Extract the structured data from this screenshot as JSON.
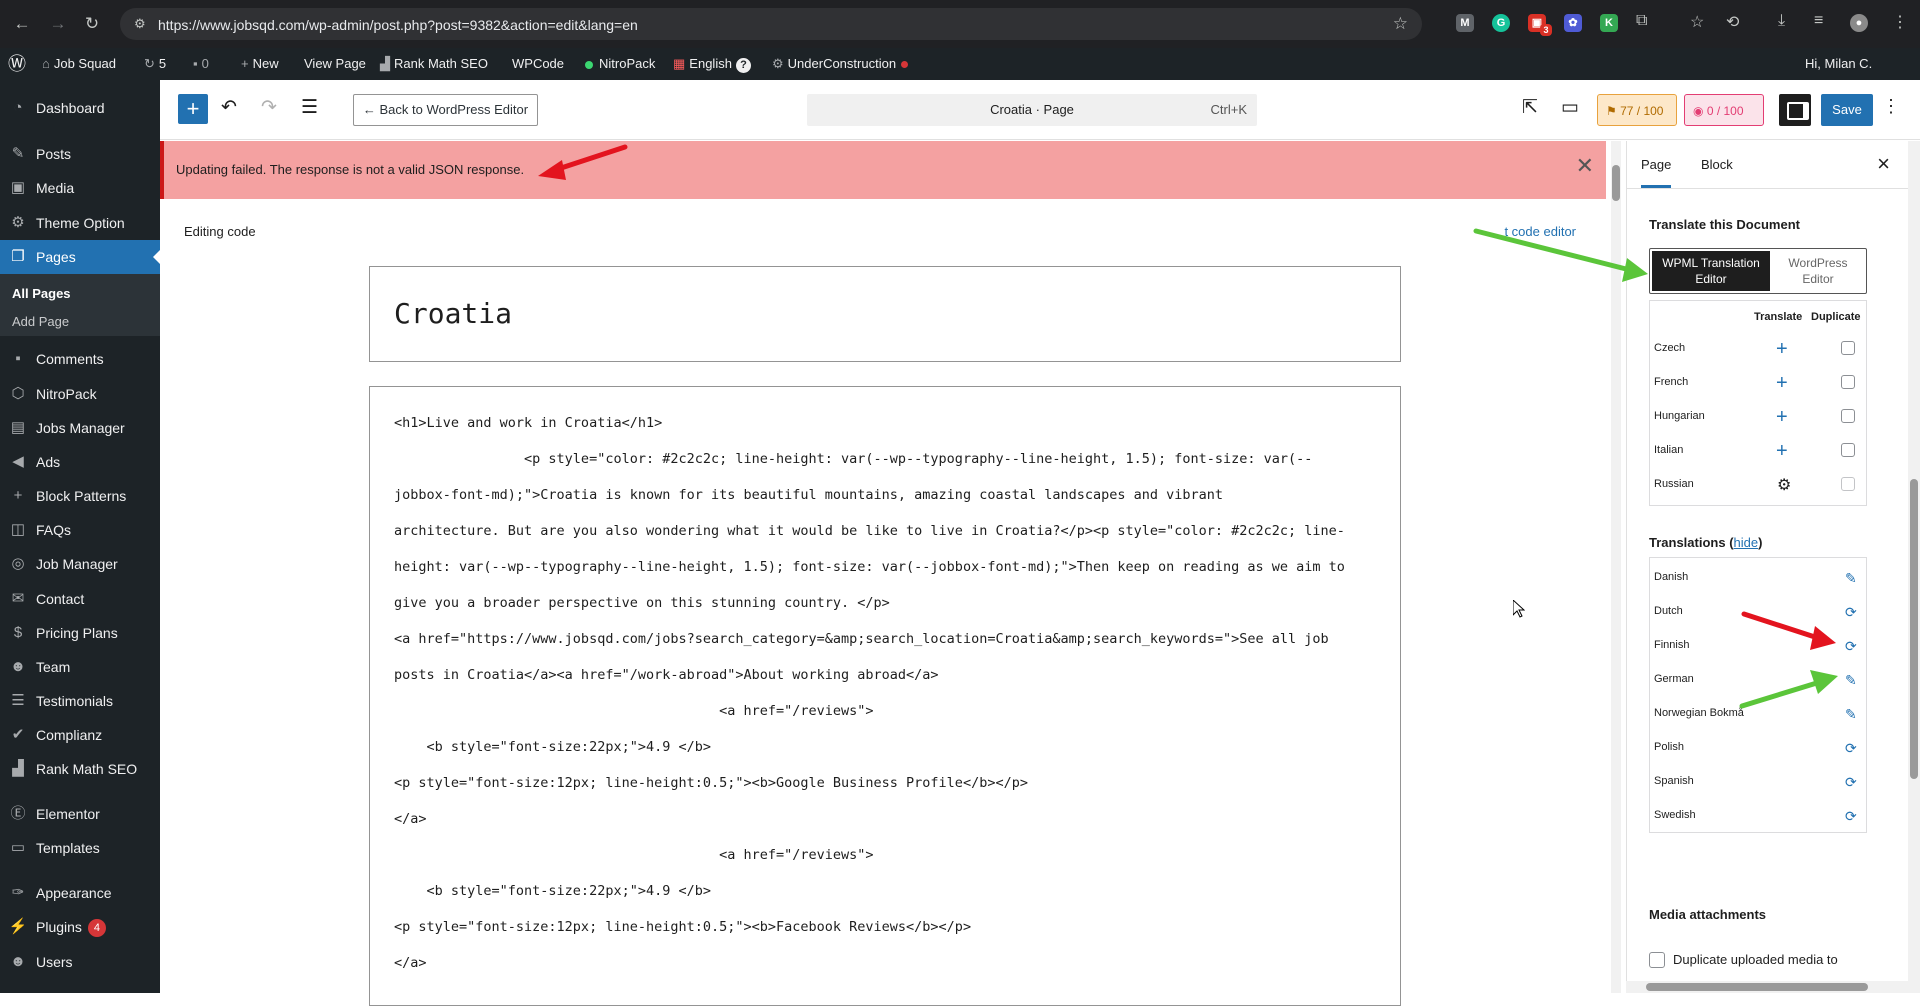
{
  "browser": {
    "url": "https://www.jobsqd.com/wp-admin/post.php?post=9382&action=edit&lang=en",
    "ext_badge": "3"
  },
  "adminbar": {
    "site_name": "Job Squad",
    "updates_count": "5",
    "comments_count": "0",
    "new_label": "New",
    "view_page": "View Page",
    "rank_math": "Rank Math SEO",
    "wpcode": "WPCode",
    "nitropack": "NitroPack",
    "language": "English",
    "under_construction": "UnderConstruction",
    "greeting": "Hi, Milan C."
  },
  "sidebar": {
    "items": [
      {
        "label": "Dashboard",
        "icon": "dashboard-icon"
      },
      {
        "label": "Posts",
        "icon": "pin-icon"
      },
      {
        "label": "Media",
        "icon": "media-icon"
      },
      {
        "label": "Theme Option",
        "icon": "gear-icon"
      },
      {
        "label": "Pages",
        "icon": "pages-icon"
      },
      {
        "label": "Comments",
        "icon": "comment-icon"
      },
      {
        "label": "NitroPack",
        "icon": "nitropack-icon"
      },
      {
        "label": "Jobs Manager",
        "icon": "briefcase-icon"
      },
      {
        "label": "Ads",
        "icon": "megaphone-icon"
      },
      {
        "label": "Block Patterns",
        "icon": "plus-icon"
      },
      {
        "label": "FAQs",
        "icon": "bubble-icon"
      },
      {
        "label": "Job Manager",
        "icon": "jm-icon"
      },
      {
        "label": "Contact",
        "icon": "mail-icon"
      },
      {
        "label": "Pricing Plans",
        "icon": "dollar-icon"
      },
      {
        "label": "Team",
        "icon": "user-icon"
      },
      {
        "label": "Testimonials",
        "icon": "list-icon"
      },
      {
        "label": "Complianz",
        "icon": "check-icon"
      },
      {
        "label": "Rank Math SEO",
        "icon": "chart-icon"
      },
      {
        "label": "Elementor",
        "icon": "elementor-icon"
      },
      {
        "label": "Templates",
        "icon": "folder-icon"
      },
      {
        "label": "Appearance",
        "icon": "brush-icon"
      },
      {
        "label": "Plugins",
        "icon": "plug-icon"
      },
      {
        "label": "Users",
        "icon": "user-icon"
      }
    ],
    "submenu": {
      "all_pages": "All Pages",
      "add_page": "Add Page"
    },
    "plugins_badge": "4"
  },
  "toolbar": {
    "back_label": "← Back to WordPress Editor",
    "doc_title": "Croatia · Page",
    "shortcut": "Ctrl+K",
    "seo_score": "77 / 100",
    "readability_score": "0 / 100",
    "save_label": "Save"
  },
  "notice": {
    "text": "Updating failed. The response is not a valid JSON response."
  },
  "editor": {
    "editing_code": "Editing code",
    "exit_code": "t code editor",
    "title": "Croatia",
    "code_lines": [
      "<h1>Live and work in Croatia</h1>",
      "                <p style=\"color: #2c2c2c; line-height: var(--wp--typography--line-height, 1.5); font-size: var(--",
      "jobbox-font-md);\">Croatia is known for its beautiful mountains, amazing coastal landscapes and vibrant",
      "architecture. But are you also wondering what it would be like to live in Croatia?</p><p style=\"color: #2c2c2c; line-",
      "height: var(--wp--typography--line-height, 1.5); font-size: var(--jobbox-font-md);\">Then keep on reading as we aim to",
      "give you a broader perspective on this stunning country. </p>",
      "<a href=\"https://www.jobsqd.com/jobs?search_category=&amp;search_location=Croatia&amp;search_keywords=\">See all job",
      "posts in Croatia</a><a href=\"/work-abroad\">About working abroad</a>",
      "                                        <a href=\"/reviews\">",
      "    <b style=\"font-size:22px;\">4.9 </b>",
      "<p style=\"font-size:12px; line-height:0.5;\"><b>Google Business Profile</b></p>",
      "</a>",
      "                                        <a href=\"/reviews\">",
      "    <b style=\"font-size:22px;\">4.9 </b>",
      "<p style=\"font-size:12px; line-height:0.5;\"><b>Facebook Reviews</b></p>",
      "</a>"
    ]
  },
  "settings": {
    "tab_page": "Page",
    "tab_block": "Block",
    "translate_heading": "Translate this Document",
    "wpml_editor": "WPML Translation Editor",
    "wp_editor": "WordPress Editor",
    "col_translate": "Translate",
    "col_duplicate": "Duplicate",
    "languages": [
      {
        "name": "Czech",
        "action": "plus-icon"
      },
      {
        "name": "French",
        "action": "plus-icon"
      },
      {
        "name": "Hungarian",
        "action": "plus-icon"
      },
      {
        "name": "Italian",
        "action": "plus-icon"
      },
      {
        "name": "Russian",
        "action": "gear-icon"
      }
    ],
    "translations_label": "Translations (",
    "hide_label": "hide",
    "translations_close": ")",
    "translations": [
      {
        "name": "Danish",
        "icon": "pencil-icon"
      },
      {
        "name": "Dutch",
        "icon": "refresh-icon"
      },
      {
        "name": "Finnish",
        "icon": "refresh-icon"
      },
      {
        "name": "German",
        "icon": "pencil-icon"
      },
      {
        "name": "Norwegian Bokmå",
        "icon": "pencil-icon"
      },
      {
        "name": "Polish",
        "icon": "refresh-icon"
      },
      {
        "name": "Spanish",
        "icon": "refresh-icon"
      },
      {
        "name": "Swedish",
        "icon": "refresh-icon"
      }
    ],
    "media_heading": "Media attachments",
    "media_checkbox": "Duplicate uploaded media to"
  },
  "colors": {
    "wp_blue": "#2271b1",
    "admin_dark": "#1d2327",
    "notice_bg": "#f4a1a1",
    "arrow_red": "#e3141e",
    "arrow_green": "#5bc53a"
  }
}
